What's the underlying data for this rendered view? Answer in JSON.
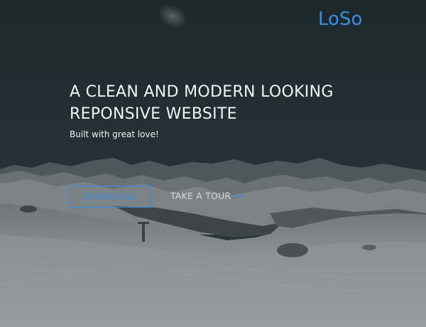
{
  "brand": {
    "logo_text": "LoSo",
    "accent_color": "#3a8ee0"
  },
  "hero": {
    "headline_line1": "A CLEAN AND MODERN LOOKING",
    "headline_line2": "REPONSIVE WEBSITE",
    "tagline": "Built with great love!",
    "download_label": "DOWNLOAD",
    "tour_label": "TAKE A TOUR",
    "tour_icon": "chevron-down-icon",
    "background": "snowy-mountain-landscape"
  }
}
